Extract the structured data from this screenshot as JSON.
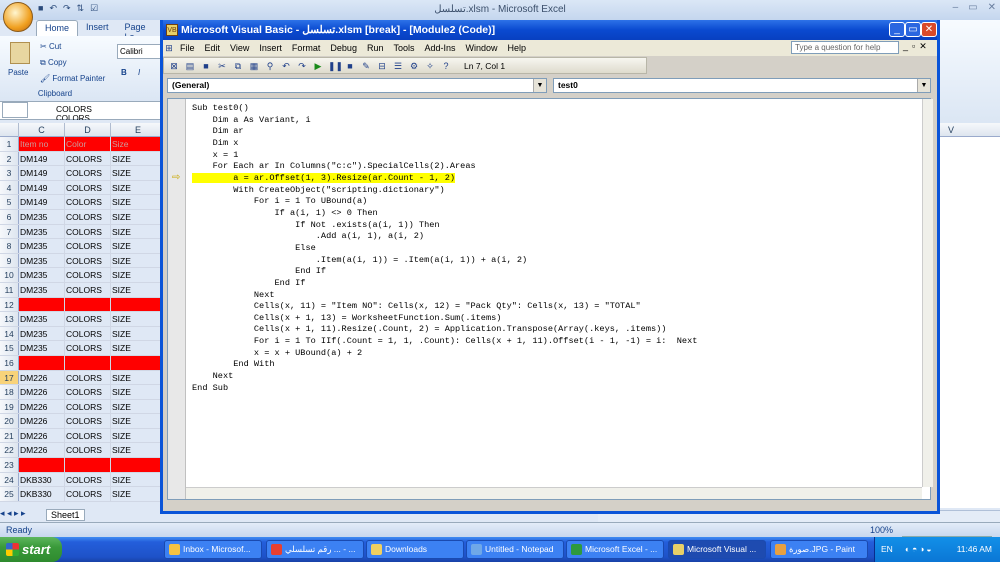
{
  "excel": {
    "title": "تسلسل.xlsm - Microsoft Excel",
    "tabs": [
      "Home",
      "Insert",
      "Page La"
    ],
    "clipboard": {
      "paste": "Paste",
      "cut": "Cut",
      "copy": "Copy",
      "format_painter": "Format Painter",
      "group": "Clipboard"
    },
    "font_name": "Calibri",
    "name_box_values": [
      "COLORS",
      "COLORS"
    ],
    "columns": [
      "C",
      "D",
      "E"
    ],
    "right_column": "V",
    "rows": [
      {
        "n": "1",
        "c": "Item no",
        "d": "Color",
        "e": "Size",
        "red": true
      },
      {
        "n": "2",
        "c": "DM149",
        "d": "COLORS",
        "e": "SIZE"
      },
      {
        "n": "3",
        "c": "DM149",
        "d": "COLORS",
        "e": "SIZE"
      },
      {
        "n": "4",
        "c": "DM149",
        "d": "COLORS",
        "e": "SIZE"
      },
      {
        "n": "5",
        "c": "DM149",
        "d": "COLORS",
        "e": "SIZE"
      },
      {
        "n": "6",
        "c": "DM235",
        "d": "COLORS",
        "e": "SIZE"
      },
      {
        "n": "7",
        "c": "DM235",
        "d": "COLORS",
        "e": "SIZE"
      },
      {
        "n": "8",
        "c": "DM235",
        "d": "COLORS",
        "e": "SIZE"
      },
      {
        "n": "9",
        "c": "DM235",
        "d": "COLORS",
        "e": "SIZE"
      },
      {
        "n": "10",
        "c": "DM235",
        "d": "COLORS",
        "e": "SIZE"
      },
      {
        "n": "11",
        "c": "DM235",
        "d": "COLORS",
        "e": "SIZE"
      },
      {
        "n": "12",
        "c": "",
        "d": "",
        "e": "",
        "red": true
      },
      {
        "n": "13",
        "c": "DM235",
        "d": "COLORS",
        "e": "SIZE"
      },
      {
        "n": "14",
        "c": "DM235",
        "d": "COLORS",
        "e": "SIZE"
      },
      {
        "n": "15",
        "c": "DM235",
        "d": "COLORS",
        "e": "SIZE"
      },
      {
        "n": "16",
        "c": "",
        "d": "",
        "e": "",
        "red": true
      },
      {
        "n": "17",
        "c": "DM226",
        "d": "COLORS",
        "e": "SIZE"
      },
      {
        "n": "18",
        "c": "DM226",
        "d": "COLORS",
        "e": "SIZE"
      },
      {
        "n": "19",
        "c": "DM226",
        "d": "COLORS",
        "e": "SIZE"
      },
      {
        "n": "20",
        "c": "DM226",
        "d": "COLORS",
        "e": "SIZE"
      },
      {
        "n": "21",
        "c": "DM226",
        "d": "COLORS",
        "e": "SIZE"
      },
      {
        "n": "22",
        "c": "DM226",
        "d": "COLORS",
        "e": "SIZE"
      },
      {
        "n": "23",
        "c": "",
        "d": "",
        "e": "",
        "red": true
      },
      {
        "n": "24",
        "c": "DKB330",
        "d": "COLORS",
        "e": "SIZE"
      },
      {
        "n": "25",
        "c": "DKB330",
        "d": "COLORS",
        "e": "SIZE"
      }
    ],
    "sheet_tab": "Sheet1",
    "status": "Ready",
    "zoom": "100%"
  },
  "vba": {
    "title": "Microsoft Visual Basic - تسلسل.xlsm [break] - [Module2 (Code)]",
    "menu": [
      "File",
      "Edit",
      "View",
      "Insert",
      "Format",
      "Debug",
      "Run",
      "Tools",
      "Add-Ins",
      "Window",
      "Help"
    ],
    "help_placeholder": "Type a question for help",
    "position": "Ln 7, Col 1",
    "object_combo": "(General)",
    "proc_combo": "test0",
    "code_lines": [
      "Sub test0()",
      "    Dim a As Variant, i",
      "    Dim ar",
      "    Dim x",
      "    x = 1",
      "    For Each ar In Columns(\"c:c\").SpecialCells(2).Areas",
      "        a = ar.Offset(1, 3).Resize(ar.Count - 1, 2)",
      "        With CreateObject(\"scripting.dictionary\")",
      "            For i = 1 To UBound(a)",
      "                If a(i, 1) <> 0 Then",
      "                    If Not .exists(a(i, 1)) Then",
      "                        .Add a(i, 1), a(i, 2)",
      "                    Else",
      "                        .Item(a(i, 1)) = .Item(a(i, 1)) + a(i, 2)",
      "                    End If",
      "                End If",
      "            Next",
      "            Cells(x, 11) = \"Item NO\": Cells(x, 12) = \"Pack Qty\": Cells(x, 13) = \"TOTAL\"",
      "            Cells(x + 1, 13) = WorksheetFunction.Sum(.items)",
      "            Cells(x + 1, 11).Resize(.Count, 2) = Application.Transpose(Array(.keys, .items))",
      "            For i = 1 To IIf(.Count = 1, 1, .Count): Cells(x + 1, 11).Offset(i - 1, -1) = i:  Next",
      "            x = x + UBound(a) + 2",
      "        End With",
      "    Next",
      "End Sub"
    ],
    "highlight_line": 6
  },
  "taskbar": {
    "start": "start",
    "tasks": [
      {
        "label": "Inbox - Microsof...",
        "color": "#f5c242"
      },
      {
        "label": "رقم تسلسلي ... - ...",
        "color": "#e84030"
      },
      {
        "label": "Downloads",
        "color": "#f0d060"
      },
      {
        "label": "Untitled - Notepad",
        "color": "#6fa8e8"
      },
      {
        "label": "Microsoft Excel - ...",
        "color": "#2e9a3e"
      },
      {
        "label": "Microsoft Visual ...",
        "color": "#e8d068",
        "active": true
      },
      {
        "label": "صورة.JPG - Paint",
        "color": "#e8a040"
      }
    ],
    "lang": "EN",
    "time": "11:46 AM"
  }
}
